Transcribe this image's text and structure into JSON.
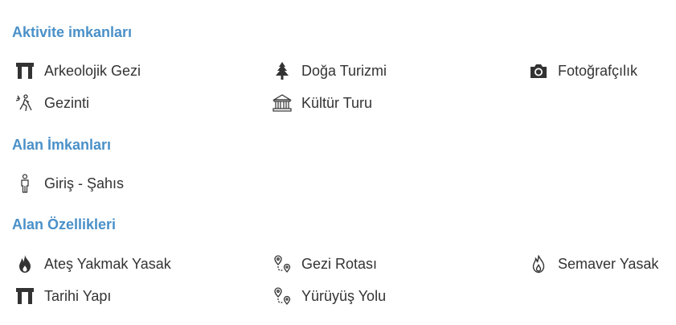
{
  "sections": [
    {
      "title": "Aktivite imkanları",
      "items": [
        {
          "label": "Arkeolojik Gezi",
          "icon": "gate-icon"
        },
        {
          "label": "Doğa Turizmi",
          "icon": "tree-icon"
        },
        {
          "label": "Fotoğrafçılık",
          "icon": "camera-icon"
        },
        {
          "label": "Gezinti",
          "icon": "hiker-icon"
        },
        {
          "label": "Kültür Turu",
          "icon": "museum-icon"
        }
      ]
    },
    {
      "title": "Alan İmkanları",
      "items": [
        {
          "label": "Giriş - Şahıs",
          "icon": "person-icon"
        }
      ]
    },
    {
      "title": "Alan Özellikleri",
      "items": [
        {
          "label": "Ateş Yakmak Yasak",
          "icon": "fire-icon"
        },
        {
          "label": "Gezi Rotası",
          "icon": "route-icon"
        },
        {
          "label": "Semaver Yasak",
          "icon": "flame-outline-icon"
        },
        {
          "label": "Tarihi Yapı",
          "icon": "gate-icon"
        },
        {
          "label": "Yürüyüş Yolu",
          "icon": "route-icon"
        }
      ]
    }
  ],
  "colors": {
    "heading": "#4a90c8",
    "text": "#333333",
    "icon": "#333333"
  }
}
